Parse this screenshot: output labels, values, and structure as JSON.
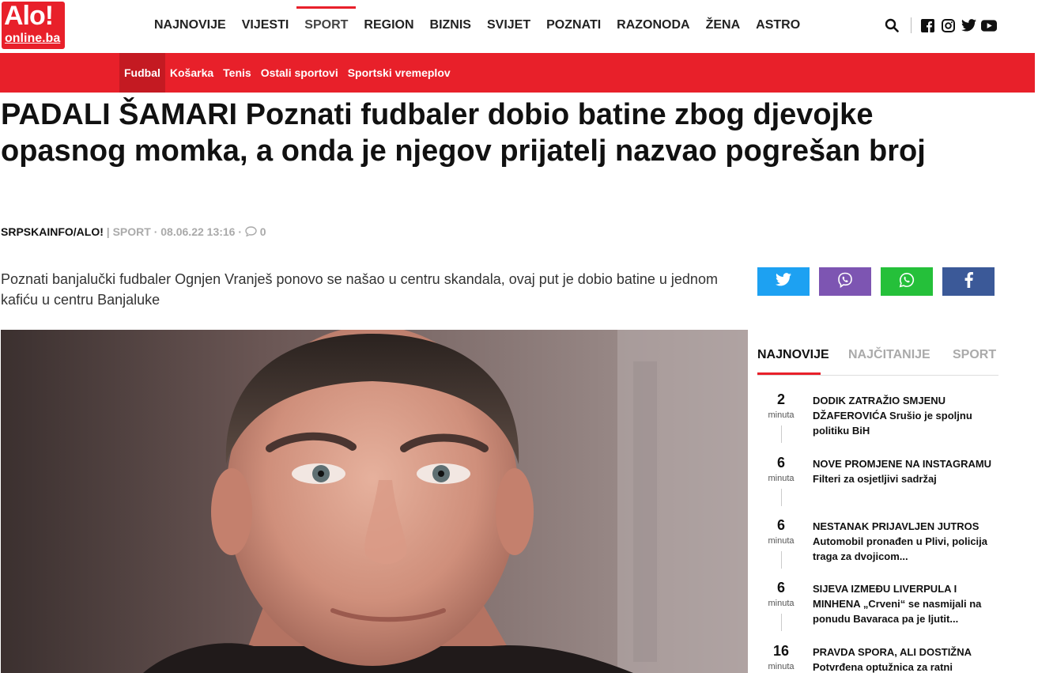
{
  "logo": {
    "line1": "Alo!",
    "line2": "online.ba"
  },
  "main_nav": [
    {
      "label": "NAJNOVIJE"
    },
    {
      "label": "VIJESTI"
    },
    {
      "label": "SPORT"
    },
    {
      "label": "REGION"
    },
    {
      "label": "BIZNIS"
    },
    {
      "label": "SVIJET"
    },
    {
      "label": "POZNATI"
    },
    {
      "label": "RAZONODA"
    },
    {
      "label": "ŽENA"
    },
    {
      "label": "ASTRO"
    }
  ],
  "header_icons": [
    "search-icon",
    "facebook-icon",
    "instagram-icon",
    "twitter-icon",
    "youtube-icon"
  ],
  "sub_nav": [
    {
      "label": "Fudbal"
    },
    {
      "label": "Košarka"
    },
    {
      "label": "Tenis"
    },
    {
      "label": "Ostali sportovi"
    },
    {
      "label": "Sportski vremeplov"
    }
  ],
  "article": {
    "headline": "PADALI ŠAMARI Poznati fudbaler dobio batine zbog djevojke opasnog momka, a onda je njegov prijatelj nazvao pogrešan broj",
    "source": "SRPSKAINFO/ALO!",
    "separator": "|",
    "category": "SPORT",
    "date": "· 08.06.22 13:16 ·",
    "comments": "0",
    "lead": "Poznati banjalučki fudbaler Ognjen Vranješ ponovo se našao u centru skandala, ovaj put je dobio batine u jednom kafiću u centru Banjaluke"
  },
  "share_buttons": [
    {
      "icon": "twitter-icon",
      "color": "#1da1f2"
    },
    {
      "icon": "viber-icon",
      "color": "#7d55b2"
    },
    {
      "icon": "whatsapp-icon",
      "color": "#25c03a"
    },
    {
      "icon": "facebook-icon",
      "color": "#3b5998"
    }
  ],
  "colors": {
    "brand_red": "#e8202a",
    "brand_dark_red": "#c41a22"
  },
  "sidebar": {
    "tabs": [
      {
        "label": "NAJNOVIJE"
      },
      {
        "label": "NAJČITANIJE"
      },
      {
        "label": "SPORT"
      }
    ],
    "items": [
      {
        "num": "2",
        "unit": "minuta",
        "title": "DODIK ZATRAŽIO SMJENU DŽAFEROVIĆA",
        "rest": "Srušio je spoljnu politiku BiH"
      },
      {
        "num": "6",
        "unit": "minuta",
        "title": "NOVE PROMJENE NA INSTAGRAMU",
        "rest": "Filteri za osjetljivi sadržaj"
      },
      {
        "num": "6",
        "unit": "minuta",
        "title": "NESTANAK PRIJAVLJEN JUTROS",
        "rest": "Automobil pronađen u Plivi, policija traga za dvojicom..."
      },
      {
        "num": "6",
        "unit": "minuta",
        "title": "SIJEVA IZMEĐU LIVERPULA I MINHENA",
        "rest": "„Crveni“ se nasmijali na ponudu Bavaraca pa je ljutit..."
      },
      {
        "num": "16",
        "unit": "minuta",
        "title": "PRAVDA SPORA, ALI DOSTIŽNA",
        "rest": "Potvrđena optužnica za ratni"
      }
    ]
  }
}
